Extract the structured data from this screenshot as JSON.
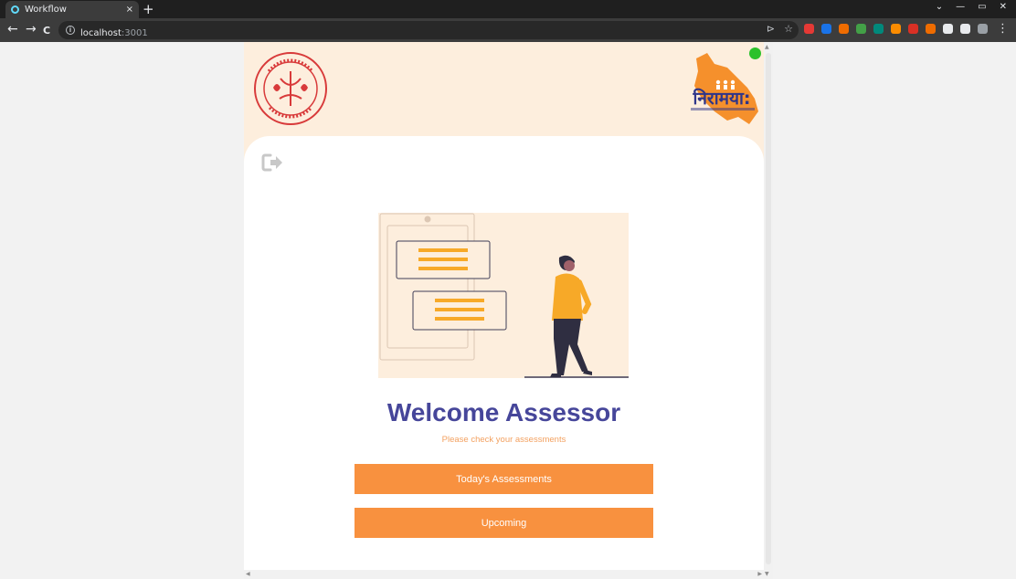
{
  "browser": {
    "tab_title": "Workflow",
    "tab_close": "×",
    "new_tab": "+",
    "window_controls": [
      "⌄",
      "—",
      "▭",
      "✕"
    ],
    "url_host": "localhost",
    "url_port": ":3001",
    "nav": {
      "back": "←",
      "forward": "→",
      "reload": "C"
    },
    "omni_icons": [
      "⊳",
      "☆"
    ],
    "menu": "⋮",
    "extensions": [
      "#e53935",
      "#1a73e8",
      "#ef6c00",
      "#43a047",
      "#00897b",
      "#fb8c00",
      "#d93025",
      "#ef6c00",
      "#e8eaed",
      "#e8eaed",
      "#9aa0a6"
    ]
  },
  "page": {
    "status_color": "#2bc12b",
    "emblem_icon": "state-emblem-icon",
    "brand_logo": "niramaya-logo",
    "logout_icon": "sign-out-icon",
    "illustration": "person-with-documents-illustration",
    "welcome_title": "Welcome Assessor",
    "subtitle": "Please check your assessments",
    "buttons": {
      "today": "Today's Assessments",
      "upcoming": "Upcoming"
    },
    "accent_color": "#f8913f",
    "title_color": "#46469a"
  }
}
